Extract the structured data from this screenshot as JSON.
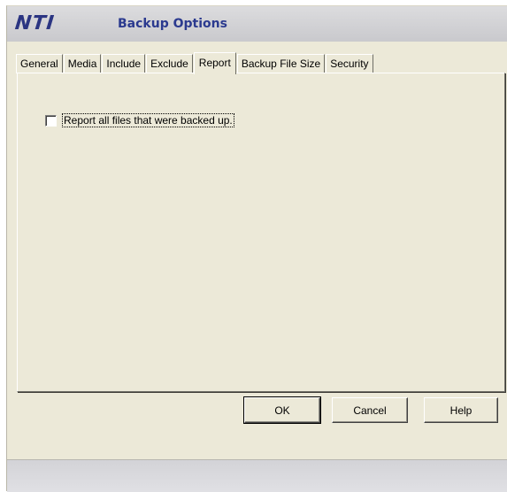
{
  "window": {
    "logo": "NTI",
    "title": "Backup Options"
  },
  "tabs": [
    {
      "label": "General"
    },
    {
      "label": "Media"
    },
    {
      "label": "Include"
    },
    {
      "label": "Exclude"
    },
    {
      "label": "Report",
      "active": true
    },
    {
      "label": "Backup File Size"
    },
    {
      "label": "Security"
    }
  ],
  "report": {
    "report_all_files_label": "Report all files that were backed up.",
    "report_all_files_checked": false
  },
  "buttons": {
    "ok": "OK",
    "cancel": "Cancel",
    "help": "Help"
  }
}
